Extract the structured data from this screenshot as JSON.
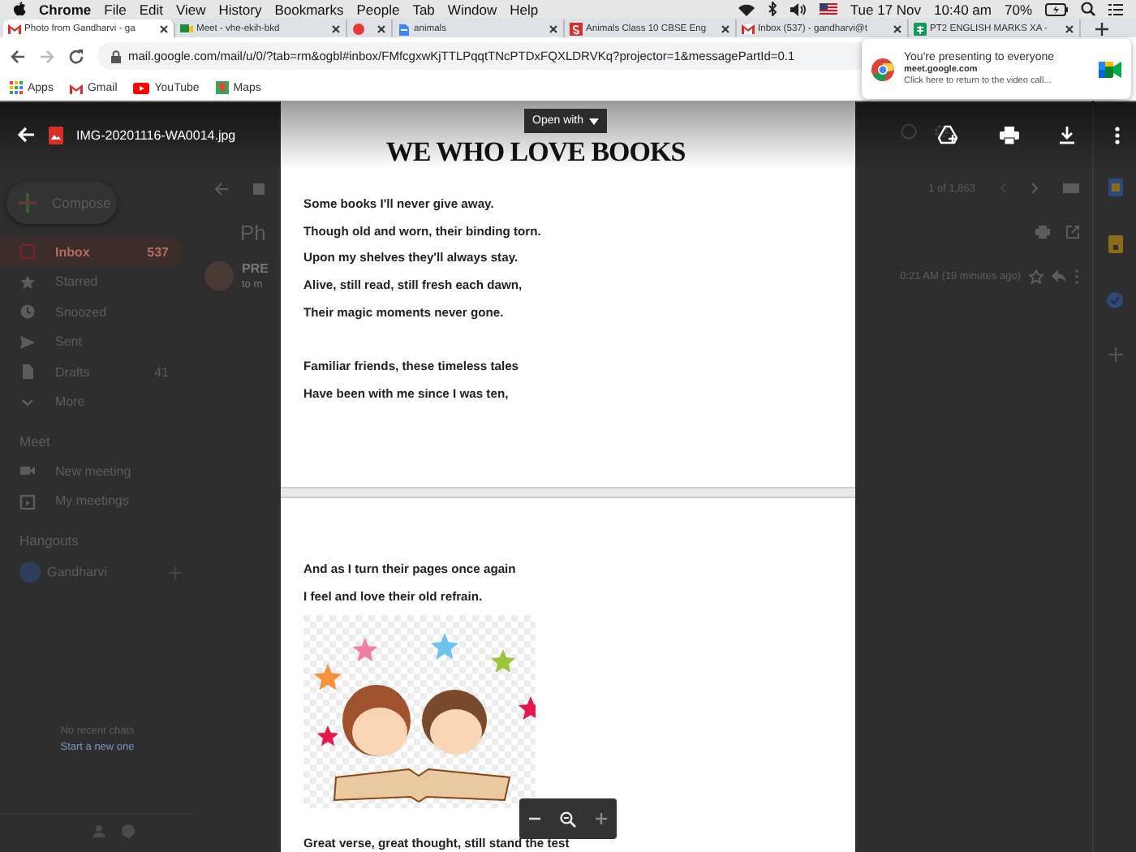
{
  "menubar": {
    "app": "Chrome",
    "menus": [
      "File",
      "Edit",
      "View",
      "History",
      "Bookmarks",
      "People",
      "Tab",
      "Window",
      "Help"
    ],
    "date": "Tue 17 Nov",
    "time": "10:40 am",
    "battery": "70%"
  },
  "tabs": [
    {
      "kind": "mail",
      "title": "Photo from Gandharvi - ga",
      "selected": true
    },
    {
      "kind": "camera",
      "title": "Meet - vhe-ekih-bkd",
      "selected": false
    },
    {
      "kind": "record",
      "selected": false
    },
    {
      "kind": "document",
      "title": "animals",
      "selected": false
    },
    {
      "kind": "tile",
      "title": "Animals Class 10 CBSE Eng",
      "selected": false
    },
    {
      "kind": "mail",
      "title": "Inbox (537) - gandharvi@t",
      "selected": false
    },
    {
      "kind": "sheet",
      "title": "PT2 ENGLISH MARKS XA -",
      "selected": false
    }
  ],
  "address": {
    "url": "mail.google.com/mail/u/0/?tab=rm&ogbl#inbox/FMfcgxwKjTTLPqqtTNcPTDxFQXLDRVKq?projector=1&messagePartId=0.1"
  },
  "bookmarks": [
    {
      "kind": "apps",
      "label": "Apps"
    },
    {
      "kind": "mail",
      "label": "Gmail"
    },
    {
      "kind": "video",
      "label": "YouTube"
    },
    {
      "kind": "map",
      "label": "Maps"
    }
  ],
  "notification": {
    "title": "You're presenting to everyone",
    "site": "meet.google.com",
    "hint": "Click here to return to the video call..."
  },
  "gmail": {
    "compose": "Compose",
    "nav": [
      {
        "kind": "inbox",
        "label": "Inbox",
        "count": "537",
        "selected": true
      },
      {
        "kind": "star",
        "label": "Starred",
        "selected": false
      },
      {
        "kind": "clock",
        "label": "Snoozed",
        "selected": false
      },
      {
        "kind": "send",
        "label": "Sent",
        "selected": false
      },
      {
        "kind": "draft",
        "label": "Drafts",
        "count": "41",
        "selected": false
      },
      {
        "kind": "chevron",
        "label": "More",
        "selected": false
      }
    ],
    "meet": {
      "heading": "Meet",
      "items": [
        {
          "kind": "camera",
          "label": "New meeting"
        },
        {
          "kind": "calendar",
          "label": "My meetings"
        }
      ]
    },
    "hangouts": {
      "heading": "Hangouts",
      "user": "Gandharvi",
      "empty": "No recent chats",
      "link": "Start a new one"
    },
    "subject": "Ph",
    "sender": "PRE",
    "recipient": "to m",
    "pager": "1 of 1,863",
    "time": "0:21 AM (19 minutes ago)"
  },
  "viewer": {
    "filename": "IMG-20201116-WA0014.jpg",
    "open_with": "Open with",
    "title": "WE WHO LOVE BOOKS",
    "pages": [
      [
        {
          "kind": "line",
          "text": "Some books I'll never give away."
        },
        {
          "kind": "line",
          "text": "Though old and worn, their binding torn."
        },
        {
          "kind": "line",
          "text": "Upon my shelves they'll always stay."
        },
        {
          "kind": "line",
          "text": "Alive, still read, still fresh each dawn,"
        },
        {
          "kind": "line",
          "text": "Their magic moments never gone."
        },
        {
          "kind": "break"
        },
        {
          "kind": "line",
          "text": "Familiar friends, these timeless tales"
        },
        {
          "kind": "line",
          "text": "Have been with me since I was ten,"
        }
      ],
      [
        {
          "kind": "line",
          "text": "And as I turn their pages once again"
        },
        {
          "kind": "line",
          "text": "I feel and love their old refrain."
        },
        {
          "kind": "picture"
        },
        {
          "kind": "line",
          "text": "Great verse, great thought, still stand the test"
        }
      ]
    ]
  }
}
